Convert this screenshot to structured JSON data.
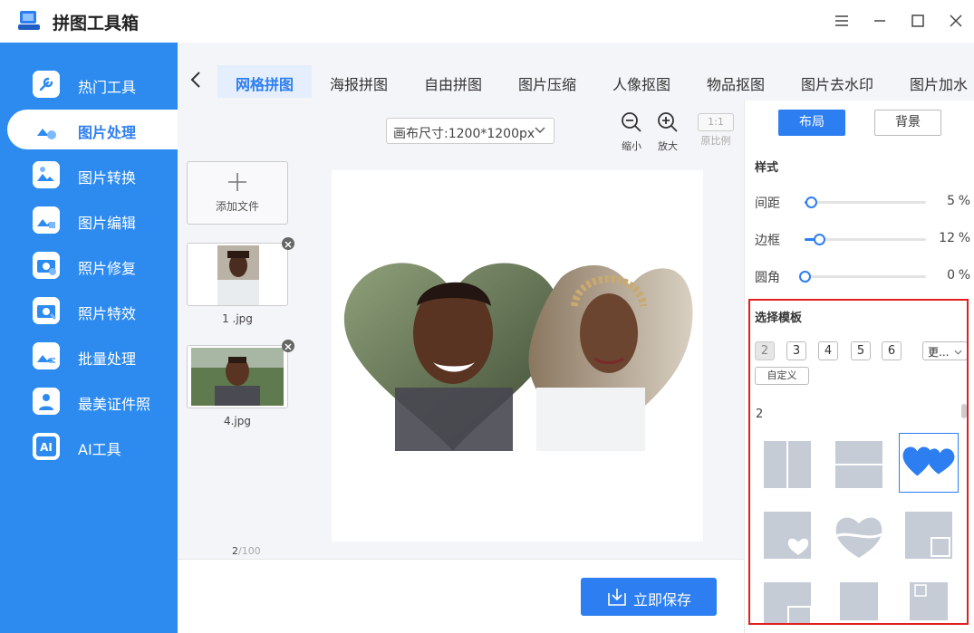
{
  "app": {
    "title": "拼图工具箱"
  },
  "sidebar": {
    "items": [
      {
        "label": "热门工具",
        "icon": "wrench-icon"
      },
      {
        "label": "图片处理",
        "icon": "image-process-icon",
        "active": true
      },
      {
        "label": "图片转换",
        "icon": "image-convert-icon"
      },
      {
        "label": "图片编辑",
        "icon": "image-edit-icon"
      },
      {
        "label": "照片修复",
        "icon": "photo-repair-icon"
      },
      {
        "label": "照片特效",
        "icon": "photo-effect-icon"
      },
      {
        "label": "批量处理",
        "icon": "batch-icon"
      },
      {
        "label": "最美证件照",
        "icon": "id-photo-icon"
      },
      {
        "label": "AI工具",
        "icon": "ai-icon"
      }
    ]
  },
  "tabs": [
    "网格拼图",
    "海报拼图",
    "自由拼图",
    "图片压缩",
    "人像抠图",
    "物品抠图",
    "图片去水印",
    "图片加水"
  ],
  "toolbar": {
    "canvas_size": "画布尺寸:1200*1200px",
    "zoom_out": "缩小",
    "zoom_in": "放大",
    "ratio_box": "1:1",
    "ratio_label": "原比例"
  },
  "files": {
    "add_label": "添加文件",
    "items": [
      {
        "name": "1 .jpg"
      },
      {
        "name": "4.jpg"
      }
    ],
    "count": "2",
    "total": "/100"
  },
  "save_label": "立即保存",
  "panel": {
    "layout_btn": "布局",
    "background_btn": "背景",
    "style_title": "样式",
    "sliders": [
      {
        "label": "间距",
        "value": 5,
        "unit": "%"
      },
      {
        "label": "边框",
        "value": 12,
        "unit": "%"
      },
      {
        "label": "圆角",
        "value": 0,
        "unit": "%"
      }
    ],
    "template_title": "选择模板",
    "counts": [
      "2",
      "3",
      "4",
      "5",
      "6"
    ],
    "more": "更...",
    "custom": "自定义",
    "group_label": "2"
  },
  "colors": {
    "accent": "#2d7ef0",
    "sidebar": "#2d8bf0",
    "highlight": "#e02020",
    "template": "#c5ccd6"
  }
}
